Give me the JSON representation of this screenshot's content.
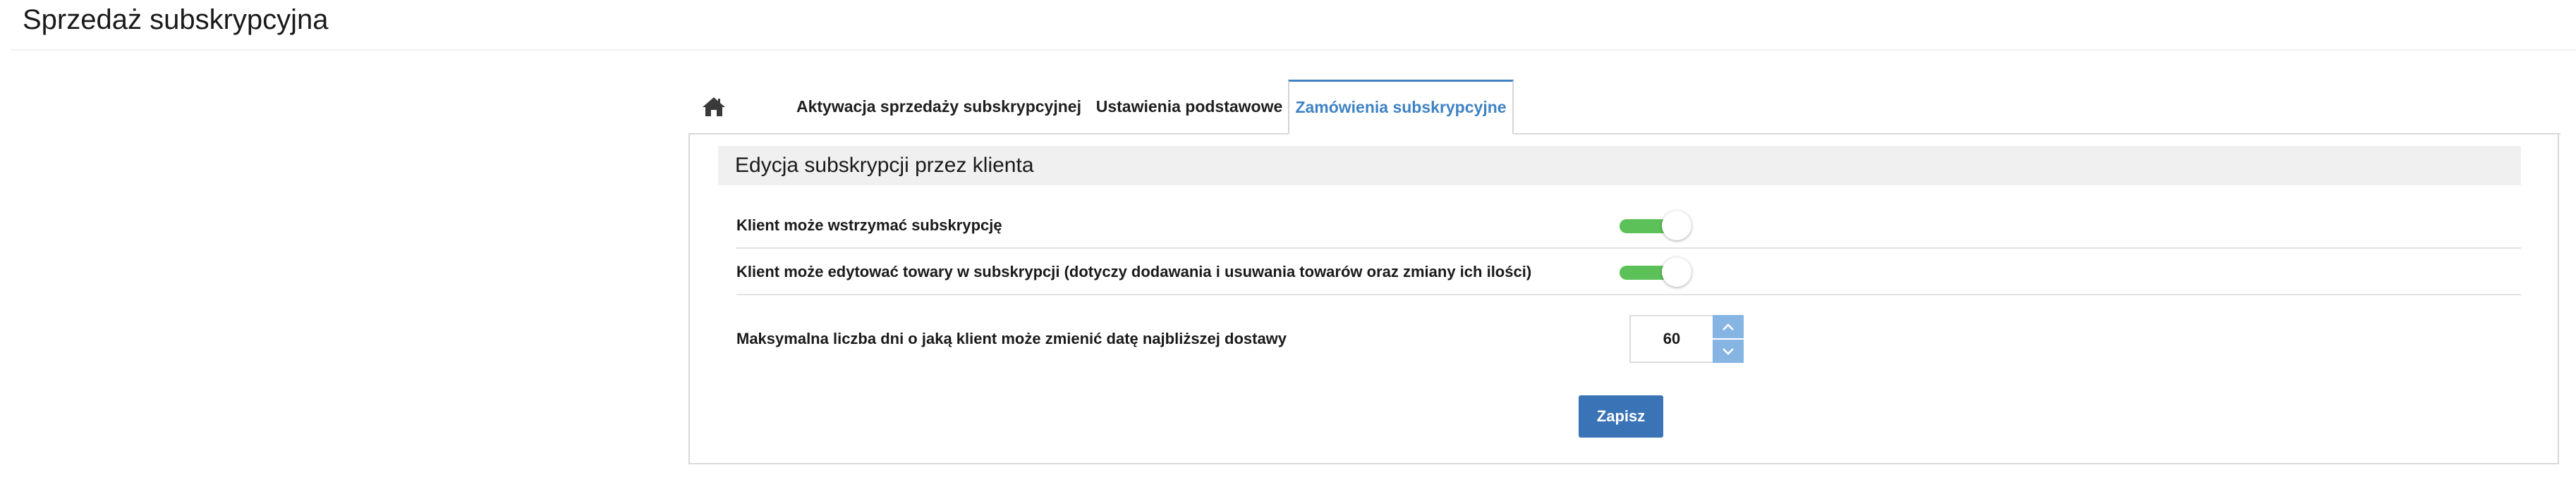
{
  "page": {
    "title": "Sprzedaż subskrypcyjna"
  },
  "tabs": [
    {
      "label": "",
      "icon": "home-icon"
    },
    {
      "label": "Aktywacja sprzedaży subskrypcyjnej"
    },
    {
      "label": "Ustawienia podstawowe"
    },
    {
      "label": "Zamówienia subskrypcyjne",
      "active": true
    }
  ],
  "section": {
    "title": "Edycja subskrypcji przez klienta"
  },
  "settings": {
    "pause_label": "Klient może wstrzymać subskrypcję",
    "pause_enabled": true,
    "edit_label": "Klient może edytować towary w subskrypcji (dotyczy dodawania i usuwania towarów oraz zmiany ich ilości)",
    "edit_enabled": true,
    "max_days_label": "Maksymalna liczba dni o jaką klient może zmienić datę najbliższej dostawy",
    "max_days_value": "60"
  },
  "actions": {
    "save_label": "Zapisz"
  },
  "colors": {
    "accent": "#3f82c4",
    "toggle_on": "#5cc158",
    "save_button": "#3a74b6",
    "stepper": "#86b5e3"
  }
}
